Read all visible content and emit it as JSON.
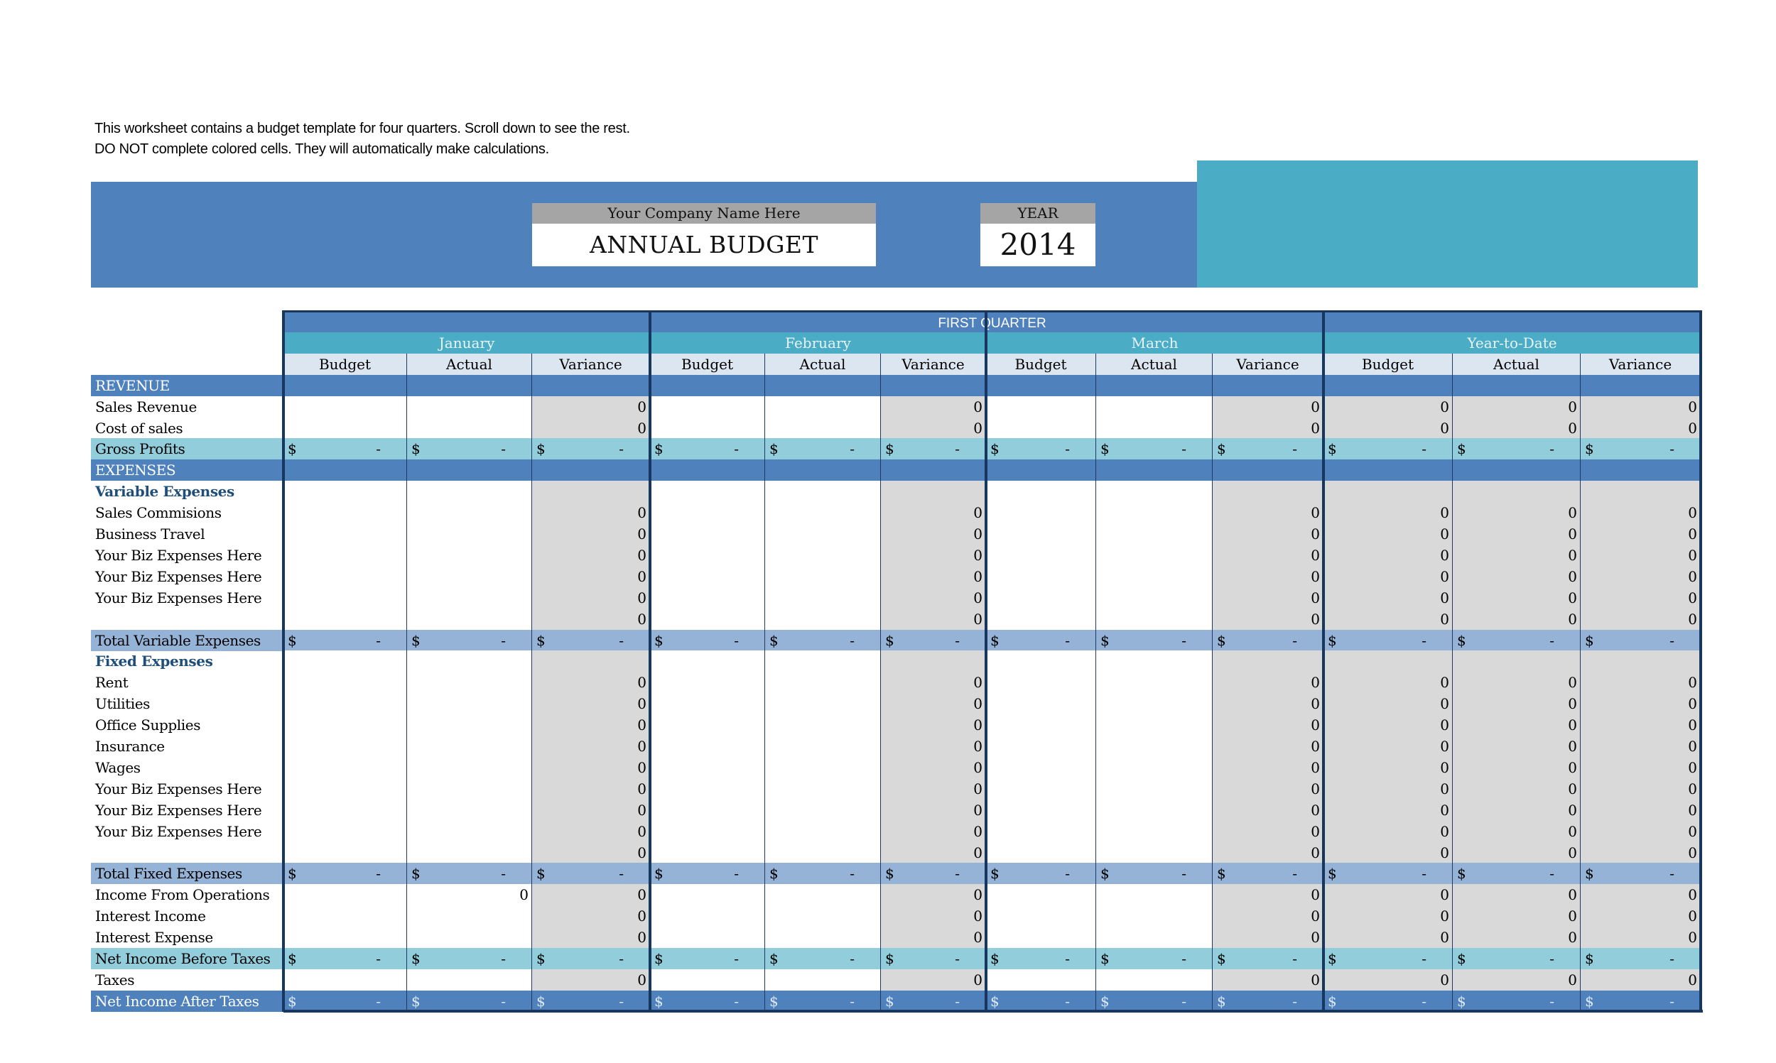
{
  "notes": {
    "line1": "This worksheet contains a budget template for four quarters. Scroll down to see the rest.",
    "line2": "DO NOT complete colored cells. They will automatically make calculations."
  },
  "header": {
    "company": "Your Company Name Here",
    "title": "ANNUAL BUDGET",
    "year_label": "YEAR",
    "year": "2014"
  },
  "colors": {
    "primary_blue": "#4f81bd",
    "teal": "#4bacc6",
    "total_row": "#95b3d7",
    "gross_row": "#92cddc",
    "calc_cell": "#d9d9d9",
    "column_header": "#dce6f1",
    "border_dark": "#17375e"
  },
  "table": {
    "quarter": "FIRST QUARTER",
    "months": [
      "January",
      "February",
      "March",
      "Year-to-Date"
    ],
    "columns": [
      "Budget",
      "Actual",
      "Variance"
    ],
    "currency_symbol": "$",
    "empty_total": "-",
    "rows": [
      {
        "label": "REVENUE",
        "type": "section"
      },
      {
        "label": "Sales Revenue",
        "type": "item"
      },
      {
        "label": "Cost of sales",
        "type": "item"
      },
      {
        "label": "Gross Profits",
        "type": "gross"
      },
      {
        "label": "EXPENSES",
        "type": "section"
      },
      {
        "label": "Variable Expenses",
        "type": "subhead"
      },
      {
        "label": "Sales Commisions",
        "type": "item"
      },
      {
        "label": "Business Travel",
        "type": "item"
      },
      {
        "label": "Your Biz Expenses Here",
        "type": "item"
      },
      {
        "label": "Your Biz Expenses Here",
        "type": "item"
      },
      {
        "label": "Your Biz Expenses Here",
        "type": "item"
      },
      {
        "label": "",
        "type": "item"
      },
      {
        "label": "Total Variable Expenses",
        "type": "total"
      },
      {
        "label": "Fixed Expenses",
        "type": "subhead"
      },
      {
        "label": "Rent",
        "type": "item"
      },
      {
        "label": "Utilities",
        "type": "item"
      },
      {
        "label": "Office Supplies",
        "type": "item"
      },
      {
        "label": "Insurance",
        "type": "item"
      },
      {
        "label": "Wages",
        "type": "item"
      },
      {
        "label": "Your Biz Expenses Here",
        "type": "item"
      },
      {
        "label": "Your Biz Expenses Here",
        "type": "item"
      },
      {
        "label": "Your Biz Expenses Here",
        "type": "item"
      },
      {
        "label": "",
        "type": "item"
      },
      {
        "label": "Total Fixed Expenses",
        "type": "total"
      },
      {
        "label": "Income From Operations",
        "type": "item",
        "jan_actual": "0"
      },
      {
        "label": "Interest Income",
        "type": "item"
      },
      {
        "label": "Interest Expense",
        "type": "item"
      },
      {
        "label": "Net Income Before Taxes",
        "type": "gross"
      },
      {
        "label": "Taxes",
        "type": "item"
      },
      {
        "label": "Net Income After Taxes",
        "type": "net"
      }
    ],
    "variance_value": "0",
    "ytd_value": "0"
  }
}
